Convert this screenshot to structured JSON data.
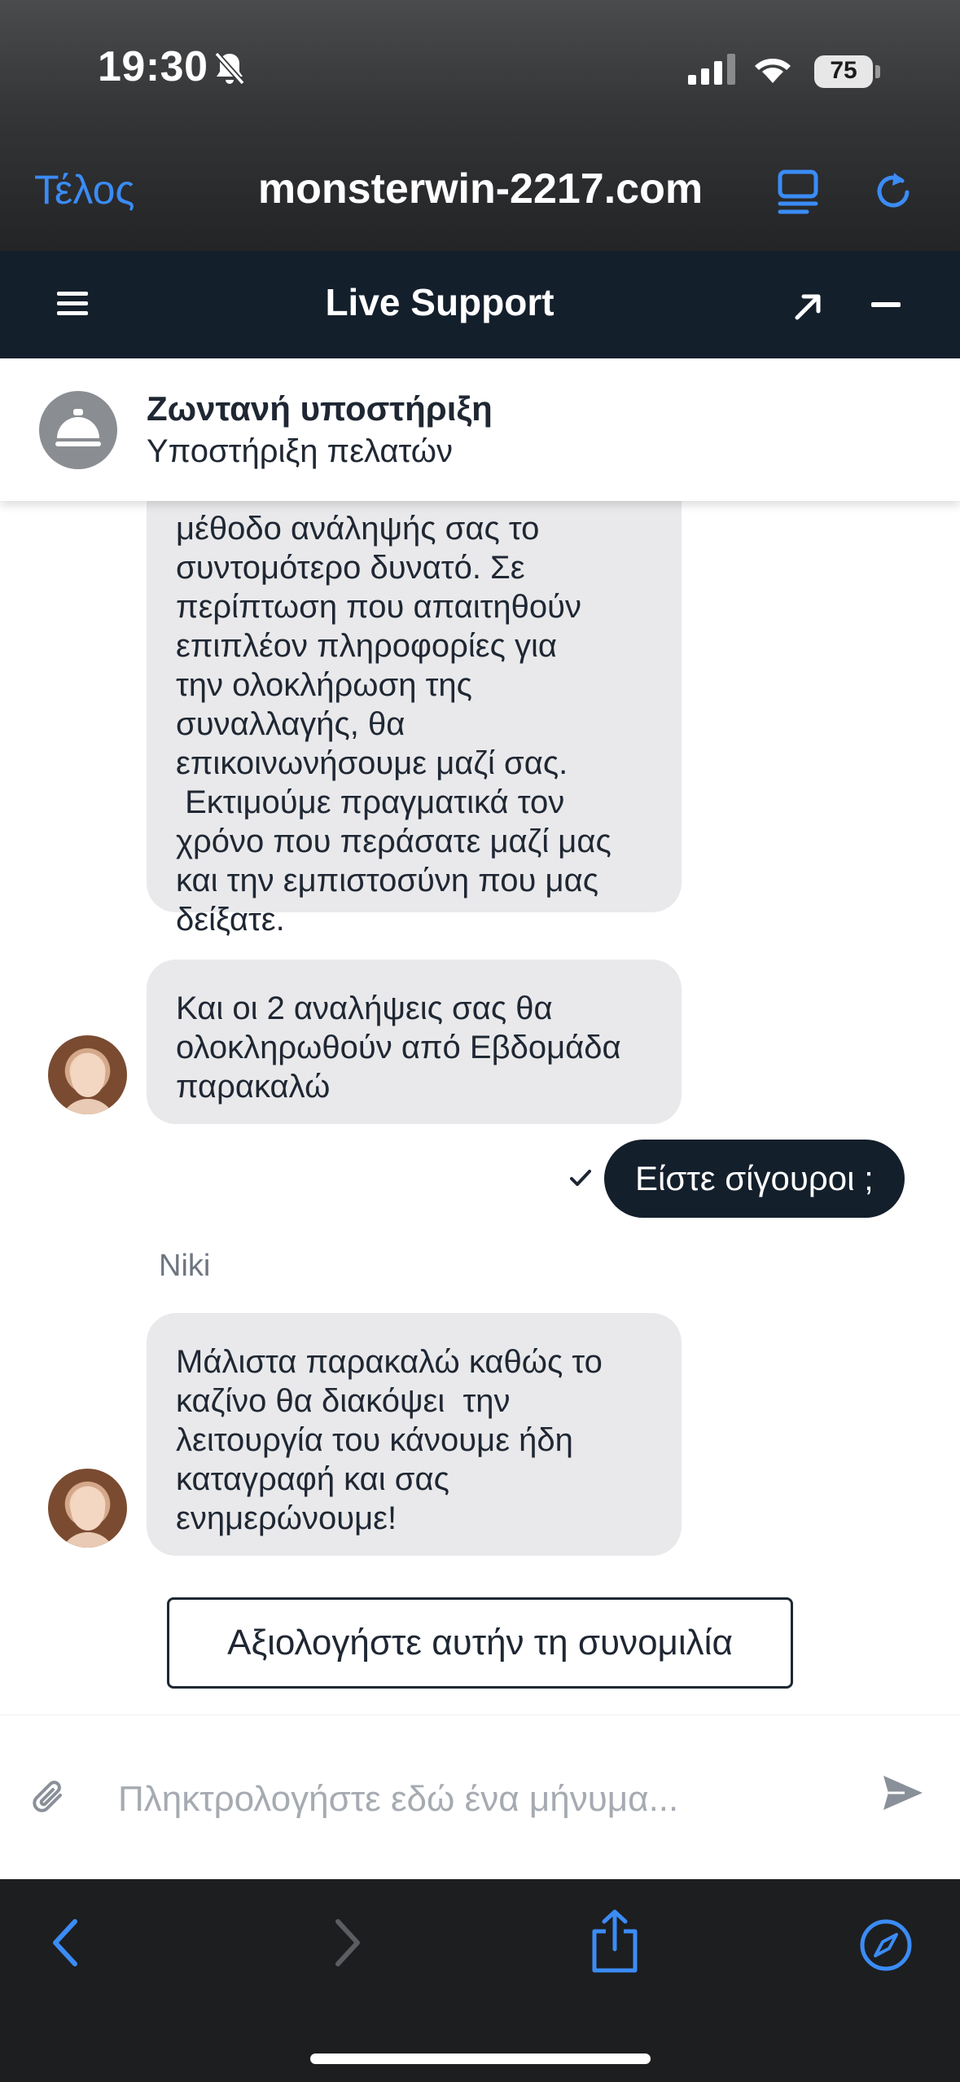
{
  "status_bar": {
    "time": "19:30",
    "battery": "75",
    "battery_level": 0.75,
    "icons": [
      "bell-slash-icon",
      "cellular-signal-icon",
      "wifi-icon",
      "battery-icon"
    ]
  },
  "browser": {
    "done_label": "Τέλος",
    "url": "monsterwin-2217.com",
    "accent": "#3b8cf5"
  },
  "widget": {
    "title": "Live Support",
    "header_color": "#141f2c"
  },
  "agent_header": {
    "title": "Ζωντανή υποστήριξη",
    "subtitle": "Υποστήριξη πελατών"
  },
  "messages": [
    {
      "direction": "incoming",
      "text": "μέθοδο ανάληψής σας το\nσυντομότερο δυνατό. Σε\nπερίπτωση που απαιτηθούν\nεπιπλέον πληροφορίες για\nτην ολοκλήρωση της\nσυναλλαγής, θα\nεπικοινωνήσουμε μαζί σας.\n Εκτιμούμε πραγματικά τον\nχρόνο που περάσατε μαζί μας\nκαι την εμπιστοσύνη που μας\nδείξατε."
    },
    {
      "direction": "incoming",
      "text": "Και οι 2 αναλήψεις σας θα\nολοκληρωθούν από Εβδομάδα\nπαρακαλώ"
    },
    {
      "direction": "outgoing",
      "text": "Είστε σίγουροι ;",
      "status": "sent"
    },
    {
      "direction": "incoming",
      "sender": "Niki",
      "text": "Μάλιστα παρακαλώ καθώς το\nκαζίνο θα διακόψει  την\nλειτουργία του κάνουμε ήδη\nκαταγραφή και σας\nενημερώνουμε!"
    }
  ],
  "rate_button": "Αξιολογήστε αυτήν τη συνομιλία",
  "composer": {
    "placeholder": "Πληκτρολογήστε εδώ ένα μήνυμα..."
  }
}
